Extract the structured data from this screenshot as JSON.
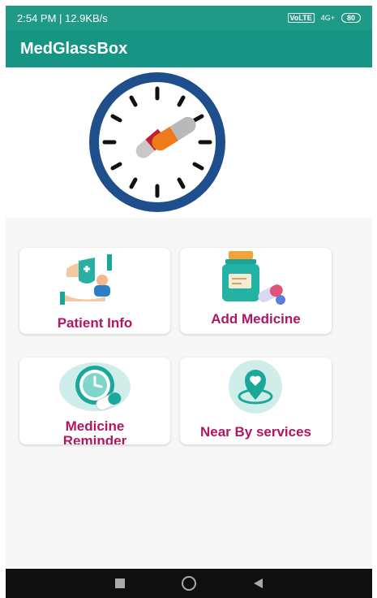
{
  "status_bar": {
    "left_text": "2:54 PM | 12.9KB/s",
    "right_chip": "VoLTE",
    "network": "4G+",
    "battery": "80"
  },
  "app_bar": {
    "title": "MedGlassBox"
  },
  "menu": {
    "patient_info": "Patient Info",
    "add_medicine": "Add Medicine",
    "medicine_reminder_line1": "Medicine",
    "medicine_reminder_line2": "Reminder",
    "near_by_services": "Near By services"
  },
  "colors": {
    "teal": "#169584",
    "label": "#b0175f",
    "clock_ring": "#1f4e8c"
  }
}
